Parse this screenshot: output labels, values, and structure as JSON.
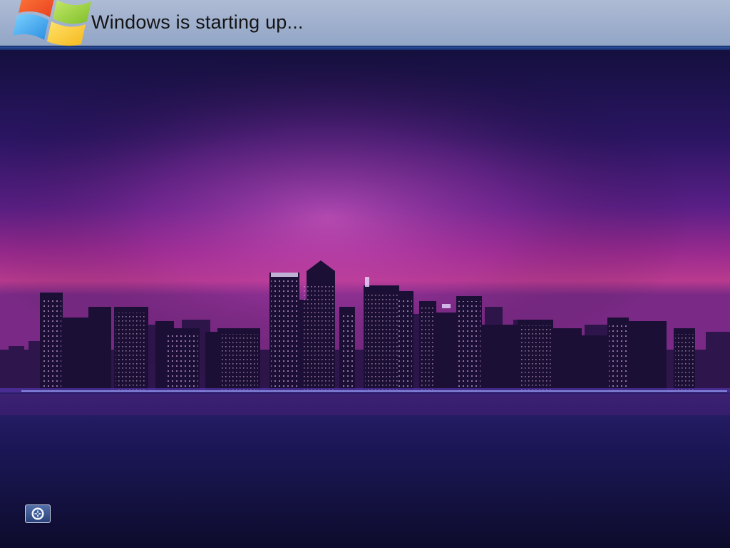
{
  "status_bar": {
    "message": "Windows is starting up..."
  },
  "wallpaper": {
    "description_icon": "city-skyline-night"
  },
  "ease_of_access": {
    "icon": "ease-of-access-icon"
  },
  "colors": {
    "status_bar_bg": "#9eafcd",
    "status_line": "#2a4d9b",
    "sky_top": "#1e1150",
    "sky_glow": "#c0309a",
    "water": "#17154a"
  }
}
